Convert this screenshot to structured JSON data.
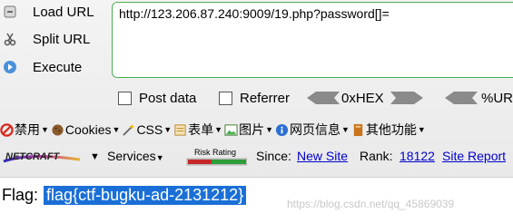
{
  "hackbar": {
    "load_url": "Load URL",
    "split_url": "Split URL",
    "execute": "Execute",
    "url_value": "http://123.206.87.240:9009/19.php?password[]="
  },
  "options": {
    "post_data": "Post data",
    "referrer": "Referrer",
    "hex": "0xHEX",
    "url": "%URL"
  },
  "chinese_toolbar": {
    "disable": "禁用",
    "cookies": "Cookies",
    "css": "CSS",
    "forms": "表单",
    "images": "图片",
    "info": "网页信息",
    "other": "其他功能"
  },
  "netcraft": {
    "logo": "NETCRAFT",
    "services": "Services",
    "risk_rating": "Risk Rating",
    "since_label": "Since:",
    "since_value": "New Site",
    "rank_label": "Rank:",
    "rank_value": "18122",
    "site_report": "Site Report"
  },
  "content": {
    "flag_label": "Flag:",
    "flag_value": "flag{ctf-bugku-ad-2131212}",
    "watermark": "https://blog.csdn.net/qq_45869039"
  }
}
